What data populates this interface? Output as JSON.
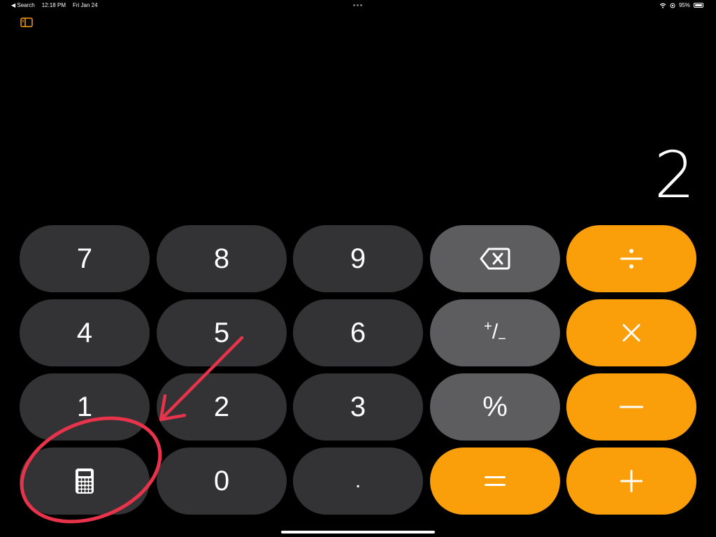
{
  "status_bar": {
    "back_label": "◀ Search",
    "time": "12:18 PM",
    "date": "Fri Jan 24",
    "battery": "95%",
    "battery_level": 0.95
  },
  "display": {
    "value": "2"
  },
  "keys": {
    "seven": "7",
    "eight": "8",
    "nine": "9",
    "four": "4",
    "five": "5",
    "six": "6",
    "one": "1",
    "two": "2",
    "three": "3",
    "zero": "0",
    "decimal": ".",
    "percent": "%",
    "plus_minus_top": "+",
    "plus_minus_bottom": "−"
  },
  "icons": {
    "backspace": "delete-left-icon",
    "divide": "divide-icon",
    "multiply": "multiply-icon",
    "minus": "minus-icon",
    "plus": "plus-icon",
    "equals": "equals-icon",
    "calculator": "calculator-icon",
    "sidebar": "sidebar-icon"
  },
  "colors": {
    "number_key": "#333335",
    "function_key": "#5d5d60",
    "operator_key": "#fa9f0a",
    "annotation": "#e8334a"
  }
}
